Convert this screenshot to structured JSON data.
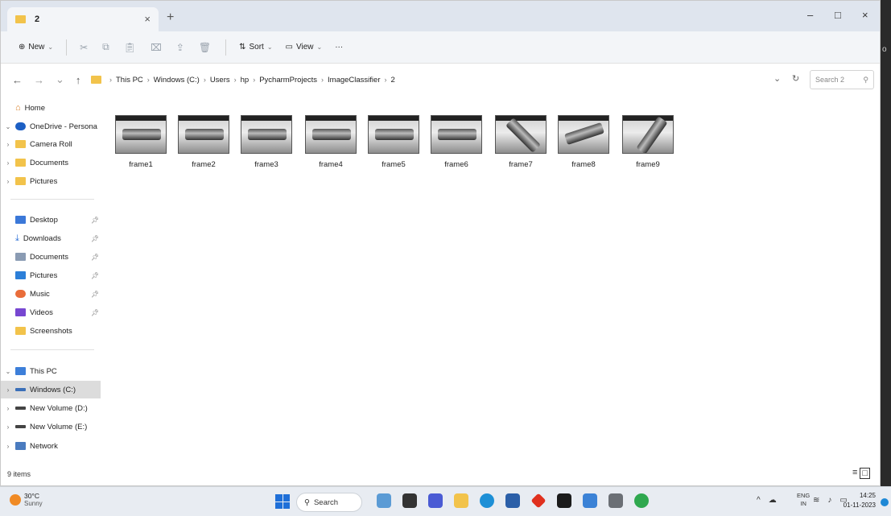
{
  "window": {
    "tab_title": "2",
    "close_tab": "×",
    "new_tab": "+",
    "minimize": "–",
    "maximize": "□",
    "close": "×"
  },
  "toolbar": {
    "new_label": "New",
    "sort_label": "Sort",
    "view_label": "View",
    "more_label": "···"
  },
  "address": {
    "crumbs": [
      "This PC",
      "Windows (C:)",
      "Users",
      "hp",
      "PycharmProjects",
      "ImageClassifier",
      "2"
    ],
    "search_placeholder": "Search 2"
  },
  "sidebar": {
    "home": "Home",
    "onedrive": "OneDrive - Persona",
    "onedrive_children": [
      "Camera Roll",
      "Documents",
      "Pictures"
    ],
    "quick_access": [
      "Desktop",
      "Downloads",
      "Documents",
      "Pictures",
      "Music",
      "Videos",
      "Screenshots"
    ],
    "this_pc": "This PC",
    "drives": [
      "Windows (C:)",
      "New Volume (D:)",
      "New Volume (E:)"
    ],
    "network": "Network"
  },
  "files": [
    "frame1",
    "frame2",
    "frame3",
    "frame4",
    "frame5",
    "frame6",
    "frame7",
    "frame8",
    "frame9"
  ],
  "status": {
    "item_count": "9 items"
  },
  "taskbar": {
    "temperature": "30°C",
    "condition": "Sunny",
    "search_label": "Search",
    "lang_top": "ENG",
    "lang_bottom": "IN",
    "time": "14:25",
    "date": "01-11-2023"
  }
}
